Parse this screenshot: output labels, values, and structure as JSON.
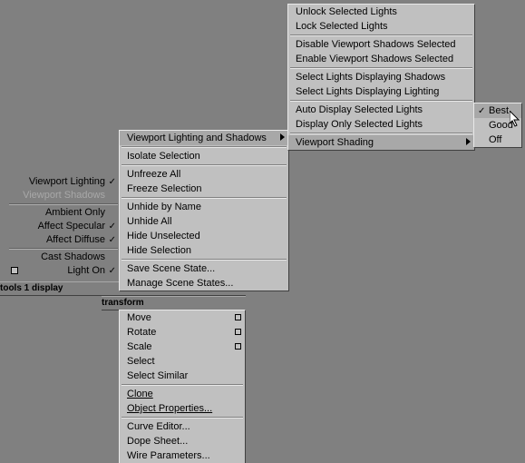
{
  "left_options": {
    "items": [
      {
        "label": "Viewport Lighting",
        "checked": true,
        "disabled": false
      },
      {
        "label": "Viewport Shadows",
        "checked": false,
        "disabled": true
      }
    ],
    "items2": [
      {
        "label": "Ambient Only",
        "checked": false
      },
      {
        "label": "Affect Specular",
        "checked": true
      },
      {
        "label": "Affect Diffuse",
        "checked": true
      }
    ],
    "items3": [
      {
        "label": "Cast Shadows",
        "checked": false
      },
      {
        "label": "Light On",
        "checked": true
      }
    ]
  },
  "bars": {
    "tools": "tools 1",
    "display": "display",
    "transform": "transform"
  },
  "display_menu": {
    "top": {
      "label": "Viewport Lighting and Shadows"
    },
    "group1": [
      "Isolate Selection"
    ],
    "group2": [
      "Unfreeze All",
      "Freeze Selection"
    ],
    "group3": [
      "Unhide by Name",
      "Unhide All",
      "Hide Unselected",
      "Hide Selection"
    ],
    "group4": [
      "Save Scene State...",
      "Manage Scene States..."
    ]
  },
  "transform_menu": {
    "group1": [
      {
        "label": "Move",
        "sq": true
      },
      {
        "label": "Rotate",
        "sq": true
      },
      {
        "label": "Scale",
        "sq": true
      },
      {
        "label": "Select",
        "sq": false
      },
      {
        "label": "Select Similar",
        "sq": false
      }
    ],
    "group2": [
      "Clone",
      "Object Properties..."
    ],
    "group3": [
      "Curve Editor...",
      "Dope Sheet...",
      "Wire Parameters..."
    ]
  },
  "vls_submenu": {
    "g1": [
      "Unlock Selected Lights",
      "Lock Selected Lights"
    ],
    "g2": [
      "Disable Viewport Shadows Selected",
      "Enable Viewport Shadows Selected"
    ],
    "g3": [
      "Select Lights Displaying Shadows",
      "Select Lights Displaying Lighting"
    ],
    "g4": [
      "Auto Display Selected Lights",
      "Display Only Selected Lights"
    ],
    "g5": {
      "label": "Viewport Shading"
    }
  },
  "shading_submenu": {
    "items": [
      {
        "label": "Best",
        "checked": true
      },
      {
        "label": "Good",
        "checked": false
      },
      {
        "label": "Off",
        "checked": false
      }
    ]
  }
}
